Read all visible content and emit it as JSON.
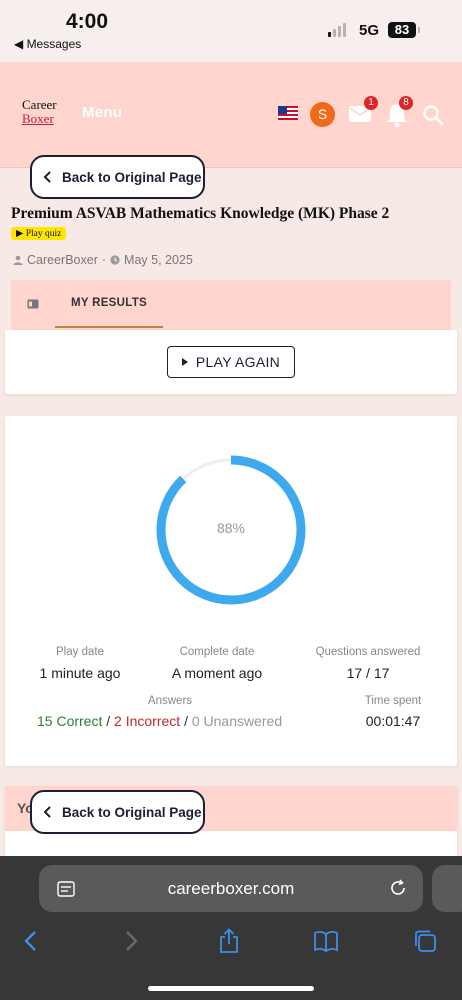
{
  "status_bar": {
    "time": "4:00",
    "back_app": "◀ Messages",
    "network": "5G",
    "battery": "83"
  },
  "header": {
    "logo_line1": "Career",
    "logo_line2": "Boxer",
    "menu_label": "Menu",
    "avatar_letter": "S",
    "mail_badge": "1",
    "bell_badge": "8"
  },
  "back_button": {
    "label": "Back to Original Page"
  },
  "quiz": {
    "title": "Premium ASVAB Mathematics Knowledge (MK) Phase 2",
    "tag": "Play quiz",
    "author": "CareerBoxer",
    "separator": "·",
    "date": "May 5, 2025"
  },
  "tabs": {
    "results_label": "MY RESULTS"
  },
  "play_again": {
    "label": "PLAY AGAIN"
  },
  "results": {
    "percent_label": "88%",
    "percent_value": 0.88,
    "play_date_label": "Play date",
    "play_date_value": "1 minute ago",
    "complete_date_label": "Complete date",
    "complete_date_value": "A moment ago",
    "questions_label": "Questions answered",
    "questions_value": "17 / 17",
    "answers_label": "Answers",
    "correct": "15 Correct",
    "incorrect": "2 Incorrect",
    "unanswered": "0 Unanswered",
    "slash": "/",
    "time_spent_label": "Time spent",
    "time_spent_value": "00:01:47",
    "ring_color": "#3ea9ef"
  },
  "your_section": {
    "header_partial": "Yo"
  },
  "safari": {
    "url": "careerboxer.com"
  }
}
